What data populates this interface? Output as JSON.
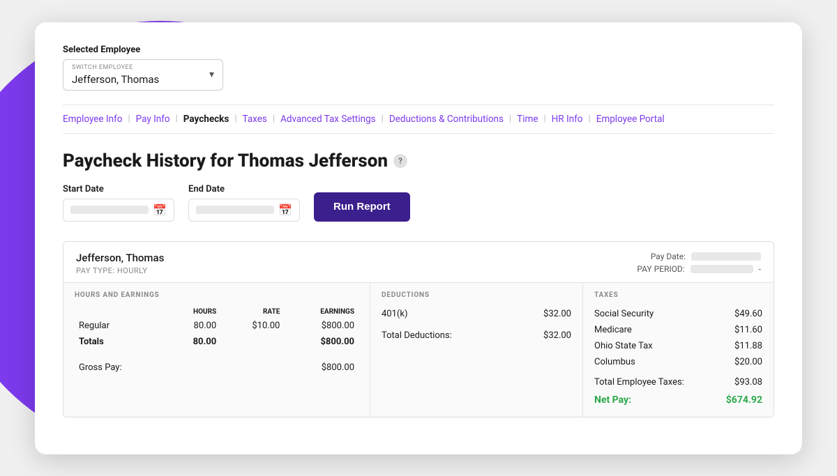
{
  "background": {
    "blob_color": "#7c3aed"
  },
  "card": {
    "selected_employee_section": {
      "label": "Selected Employee",
      "dropdown": {
        "switch_label": "SWITCH EMPLOYEE",
        "name": "Jefferson, Thomas"
      }
    },
    "nav": {
      "items": [
        {
          "id": "employee-info",
          "label": "Employee Info",
          "active": false
        },
        {
          "id": "pay-info",
          "label": "Pay Info",
          "active": false
        },
        {
          "id": "paychecks",
          "label": "Paychecks",
          "active": true
        },
        {
          "id": "taxes",
          "label": "Taxes",
          "active": false
        },
        {
          "id": "advanced-tax-settings",
          "label": "Advanced Tax Settings",
          "active": false
        },
        {
          "id": "deductions-contributions",
          "label": "Deductions & Contributions",
          "active": false
        },
        {
          "id": "time",
          "label": "Time",
          "active": false
        },
        {
          "id": "hr-info",
          "label": "HR Info",
          "active": false
        },
        {
          "id": "employee-portal",
          "label": "Employee Portal",
          "active": false
        }
      ]
    },
    "page_title": "Paycheck History for Thomas Jefferson",
    "help_icon_label": "?",
    "date_range": {
      "start_date_label": "Start Date",
      "end_date_label": "End Date",
      "run_report_label": "Run Report"
    },
    "paycheck": {
      "employee_name": "Jefferson, Thomas",
      "pay_type": "PAY TYPE: HOURLY",
      "pay_date_label": "Pay Date:",
      "pay_period_label": "PAY PERIOD:",
      "pay_period_dash": "-",
      "sections": {
        "hours_earnings": {
          "title": "HOURS AND EARNINGS",
          "columns": [
            "",
            "HOURS",
            "RATE",
            "EARNINGS"
          ],
          "rows": [
            {
              "label": "Regular",
              "hours": "80.00",
              "rate": "$10.00",
              "earnings": "$800.00"
            }
          ],
          "totals": {
            "label": "Totals",
            "hours": "80.00",
            "rate": "",
            "earnings": "$800.00"
          },
          "gross_pay_label": "Gross Pay:",
          "gross_pay_value": "$800.00"
        },
        "deductions": {
          "title": "DEDUCTIONS",
          "rows": [
            {
              "label": "401(k)",
              "value": "$32.00"
            }
          ],
          "total_label": "Total Deductions:",
          "total_value": "$32.00"
        },
        "taxes": {
          "title": "TAXES",
          "rows": [
            {
              "label": "Social Security",
              "value": "$49.60"
            },
            {
              "label": "Medicare",
              "value": "$11.60"
            },
            {
              "label": "Ohio State Tax",
              "value": "$11.88"
            },
            {
              "label": "Columbus",
              "value": "$20.00"
            }
          ],
          "total_label": "Total Employee Taxes:",
          "total_value": "$93.08",
          "net_pay_label": "Net Pay:",
          "net_pay_value": "$674.92"
        }
      }
    }
  }
}
